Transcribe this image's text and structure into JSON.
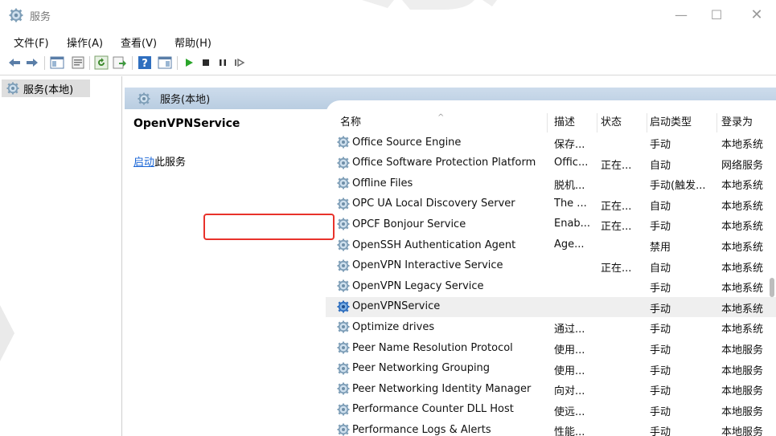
{
  "window": {
    "title": "服务",
    "icon": "gear-icon",
    "controls": {
      "minimize": "—",
      "maximize": "☐",
      "close": "✕"
    }
  },
  "menu": [
    {
      "label": "文件(F)"
    },
    {
      "label": "操作(A)"
    },
    {
      "label": "查看(V)"
    },
    {
      "label": "帮助(H)"
    }
  ],
  "toolbar": {
    "buttons": [
      "back-icon",
      "forward-icon",
      "show-hide-console-tree-icon",
      "properties-icon",
      "refresh-icon",
      "export-list-icon",
      "help-icon",
      "show-action-pane-icon",
      "start-service-icon",
      "stop-service-icon",
      "pause-service-icon",
      "restart-service-icon"
    ]
  },
  "tree": {
    "root_label": "服务(本地)"
  },
  "pane": {
    "header_label": "服务(本地)",
    "selected_service_title": "OpenVPNService",
    "action_link": "启动",
    "action_suffix": "此服务"
  },
  "table": {
    "headers": {
      "name": "名称",
      "description": "描述",
      "status": "状态",
      "startup": "启动类型",
      "logon": "登录为"
    },
    "rows": [
      {
        "name": "Office  Source Engine",
        "description": "保存...",
        "status": "",
        "startup": "手动",
        "logon": "本地系统"
      },
      {
        "name": "Office Software Protection Platform",
        "description": "Offic...",
        "status": "正在...",
        "startup": "自动",
        "logon": "网络服务"
      },
      {
        "name": "Offline Files",
        "description": "脱机...",
        "status": "",
        "startup": "手动(触发...",
        "logon": "本地系统"
      },
      {
        "name": "OPC UA Local Discovery Server",
        "description": "The ...",
        "status": "正在...",
        "startup": "自动",
        "logon": "本地系统"
      },
      {
        "name": "OPCF Bonjour Service",
        "description": "Enab...",
        "status": "正在...",
        "startup": "手动",
        "logon": "本地系统"
      },
      {
        "name": "OpenSSH Authentication Agent",
        "description": "Age...",
        "status": "",
        "startup": "禁用",
        "logon": "本地系统"
      },
      {
        "name": "OpenVPN Interactive Service",
        "description": "",
        "status": "正在...",
        "startup": "自动",
        "logon": "本地系统"
      },
      {
        "name": "OpenVPN Legacy Service",
        "description": "",
        "status": "",
        "startup": "手动",
        "logon": "本地系统"
      },
      {
        "name": "OpenVPNService",
        "description": "",
        "status": "",
        "startup": "手动",
        "logon": "本地系统"
      },
      {
        "name": "Optimize drives",
        "description": "通过...",
        "status": "",
        "startup": "手动",
        "logon": "本地系统"
      },
      {
        "name": "Peer Name Resolution Protocol",
        "description": "使用...",
        "status": "",
        "startup": "手动",
        "logon": "本地服务"
      },
      {
        "name": "Peer Networking Grouping",
        "description": "使用...",
        "status": "",
        "startup": "手动",
        "logon": "本地服务"
      },
      {
        "name": "Peer Networking Identity Manager",
        "description": "向对...",
        "status": "",
        "startup": "手动",
        "logon": "本地服务"
      },
      {
        "name": "Performance Counter DLL Host",
        "description": "使远...",
        "status": "",
        "startup": "手动",
        "logon": "本地服务"
      },
      {
        "name": "Performance Logs & Alerts",
        "description": "性能...",
        "status": "",
        "startup": "手动",
        "logon": "本地服务"
      }
    ],
    "selected_index": 8
  },
  "colors": {
    "highlight_border": "#e8322b",
    "link": "#1a66d6",
    "pane_header": "#c4d6e8",
    "selected_row": "#efefef"
  }
}
